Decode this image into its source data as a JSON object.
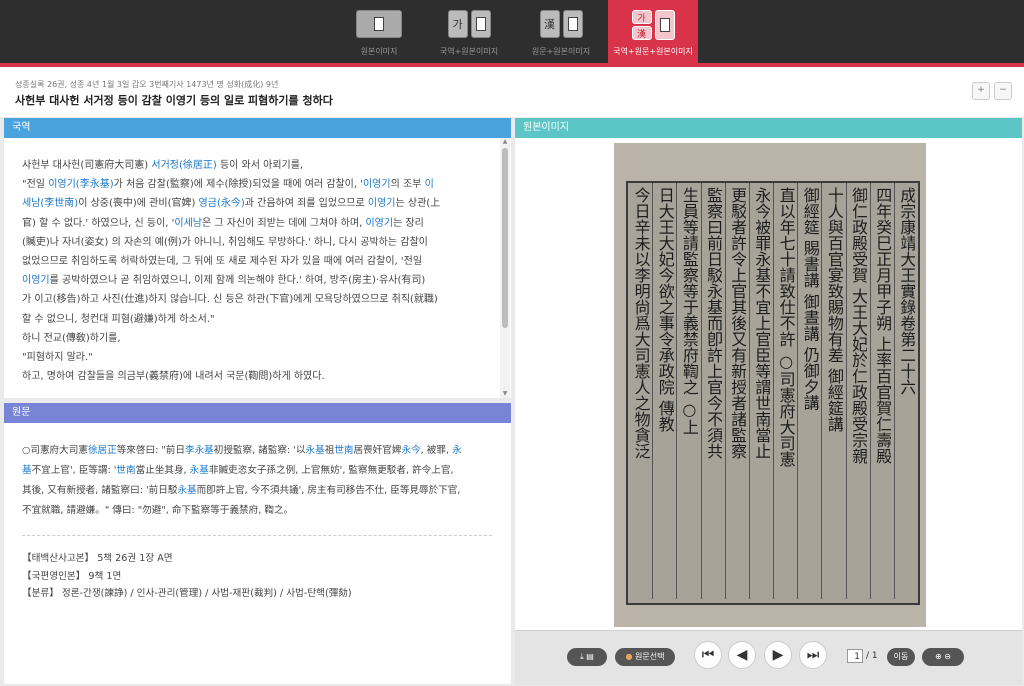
{
  "tabs": [
    {
      "label": "원본이미지"
    },
    {
      "label": "국역+원본이미지"
    },
    {
      "label": "원문+원본이미지"
    },
    {
      "label": "국역+원문+원본이미지"
    }
  ],
  "tab_glyphs": {
    "ko": "가",
    "han": "漢"
  },
  "breadcrumb": "성종실록 26권, 성종 4년 1월 3일 갑오 3번째기사 1473년 명 성화(成化) 9년",
  "title": "사헌부 대사헌 서거정 등이 감찰 이영기 등의 일로 피혐하기를 청하다",
  "zoom_buttons": {
    "in": "+",
    "out": "−"
  },
  "translation": {
    "header": "국역",
    "lines": [
      [
        {
          "t": "사헌부 대사헌(司憲府大司憲) "
        },
        {
          "t": "서거정(徐居正)",
          "l": 1
        },
        {
          "t": " 등이 와서 아뢰기를,"
        }
      ],
      [
        {
          "t": "\"전일 "
        },
        {
          "t": "이영기(李永基)",
          "l": 1
        },
        {
          "t": "가 처음 감찰(監察)에 제수(除授)되었을 때에 여러 감찰이, '"
        },
        {
          "t": "이영기",
          "l": 1
        },
        {
          "t": "의 조부 "
        },
        {
          "t": "이",
          "l": 1
        }
      ],
      [
        {
          "t": "세남(李世南)",
          "l": 1
        },
        {
          "t": "이 상중(喪中)에 관비(官婢) "
        },
        {
          "t": "영금(永今)",
          "l": 1
        },
        {
          "t": "과 간음하여 죄를 입었으므로 "
        },
        {
          "t": "이영기",
          "l": 1
        },
        {
          "t": "는 상관(上"
        }
      ],
      [
        {
          "t": "官) 할 수 없다.' 하였으나, 신 등이, '"
        },
        {
          "t": "이세남",
          "l": 1
        },
        {
          "t": "은 그 자신이 죄받는 데에 그쳐야 하며, "
        },
        {
          "t": "이영기",
          "l": 1
        },
        {
          "t": "는 장리"
        }
      ],
      [
        {
          "t": "(贓吏)나 자녀(姿女) 의 자손의 예(例)가 아니니, 취임해도 무방하다.' 하니, 다시 공박하는 감찰이"
        }
      ],
      [
        {
          "t": "없었으므로 취임하도록 허락하였는데, 그 뒤에 또 새로 제수된 자가 있을 때에 여러 감찰이, '전일"
        }
      ],
      [
        {
          "t": "이영기",
          "l": 1
        },
        {
          "t": "를 공박하였으나 곧 취임하였으니, 이제 함께 의논해야 한다.' 하여, 방주(房主)·유사(有司)"
        }
      ],
      [
        {
          "t": "가 이고(移告)하고 사진(仕進)하지 않습니다. 신 등은 하관(下官)에게 모욕당하였으므로 취직(就職)"
        }
      ],
      [
        {
          "t": "할 수 없으니, 청컨대 피혐(避嫌)하게 하소서.\""
        }
      ],
      [
        {
          "t": "하니 전교(傳敎)하기를,"
        }
      ],
      [
        {
          "t": "\"피혐하지 말라.\""
        }
      ],
      [
        {
          "t": "하고, 명하여 감찰들을 의금부(義禁府)에 내려서 국문(鞫問)하게 하였다."
        }
      ]
    ]
  },
  "original": {
    "header": "원문",
    "lines": [
      [
        {
          "t": "○司憲府大司憲"
        },
        {
          "t": "徐居正",
          "l": 1
        },
        {
          "t": "等來啓曰: \"前日"
        },
        {
          "t": "李永基",
          "l": 1
        },
        {
          "t": "初授監察, 諸監察: '以"
        },
        {
          "t": "永基",
          "l": 1
        },
        {
          "t": "祖"
        },
        {
          "t": "世南",
          "l": 1
        },
        {
          "t": "居喪奸官婢"
        },
        {
          "t": "永今",
          "l": 1
        },
        {
          "t": ", 被罪, "
        },
        {
          "t": "永",
          "l": 1
        }
      ],
      [
        {
          "t": "基",
          "l": 1
        },
        {
          "t": "不宜上官', 臣等謂: '"
        },
        {
          "t": "世南",
          "l": 1
        },
        {
          "t": "當止坐其身, "
        },
        {
          "t": "永基",
          "l": 1
        },
        {
          "t": "非贓吏恣女子孫之例, 上官無妨', 監察無更駁者, 許令上官,"
        }
      ],
      [
        {
          "t": "其後, 又有新授者, 諸監察曰: '前日駁"
        },
        {
          "t": "永基",
          "l": 1
        },
        {
          "t": "而卽許上官, 今不須共議', 房主有司移告不仕,  臣等見辱於下官,"
        }
      ],
      [
        {
          "t": "不宜就職, 請避嫌。\" 傳曰: \"勿避\", 命下監察等于義禁府, 鞫之。"
        }
      ]
    ],
    "sources": [
      "【태백산사고본】 5책 26권 1장 A면",
      "【국편영인본】 9책 1면",
      "【분류】 정론-간쟁(諫諍) / 인사-관리(管理) / 사법-재판(裁判) / 사법-탄핵(彈劾)"
    ]
  },
  "image_panel": {
    "header": "원본이미지",
    "scan_title": "成宗康靖大王實錄卷第二十六",
    "scan_columns": [
      "成宗康靖大王實錄卷第二十六",
      "四年癸巳正月甲子朔 上率百官賀仁壽殿",
      "御仁政殿受賀 大王大妃於仁政殿受宗親",
      "十人與百官宴致賜物有差 御經筵講",
      "御經筵 賜書講 御晝講 仍御夕講",
      "直以年七十請致仕不許 ○司憲府大司憲",
      "永今被罪永基不宜上官臣等謂世南當止",
      "更駁者許令上官其後又有新授者諸監察",
      "監察曰前日駁永基而卽許上官今不須共",
      "生員等請監察等于義禁府鞫之 ○上",
      "日大王大妃今欲之事令承政院 傳教",
      "今日辛未以李明尙爲大司憲人之物貪泛"
    ],
    "page_current": "1",
    "page_total": "/ 1",
    "btn_original_select": "원문선택",
    "btn_move": "이동"
  },
  "colors": {
    "accent": "#d9334a",
    "link": "#1b77c8",
    "translation_head": "#4aa3dc",
    "image_head": "#5cc6c6",
    "original_head": "#7885d6"
  }
}
